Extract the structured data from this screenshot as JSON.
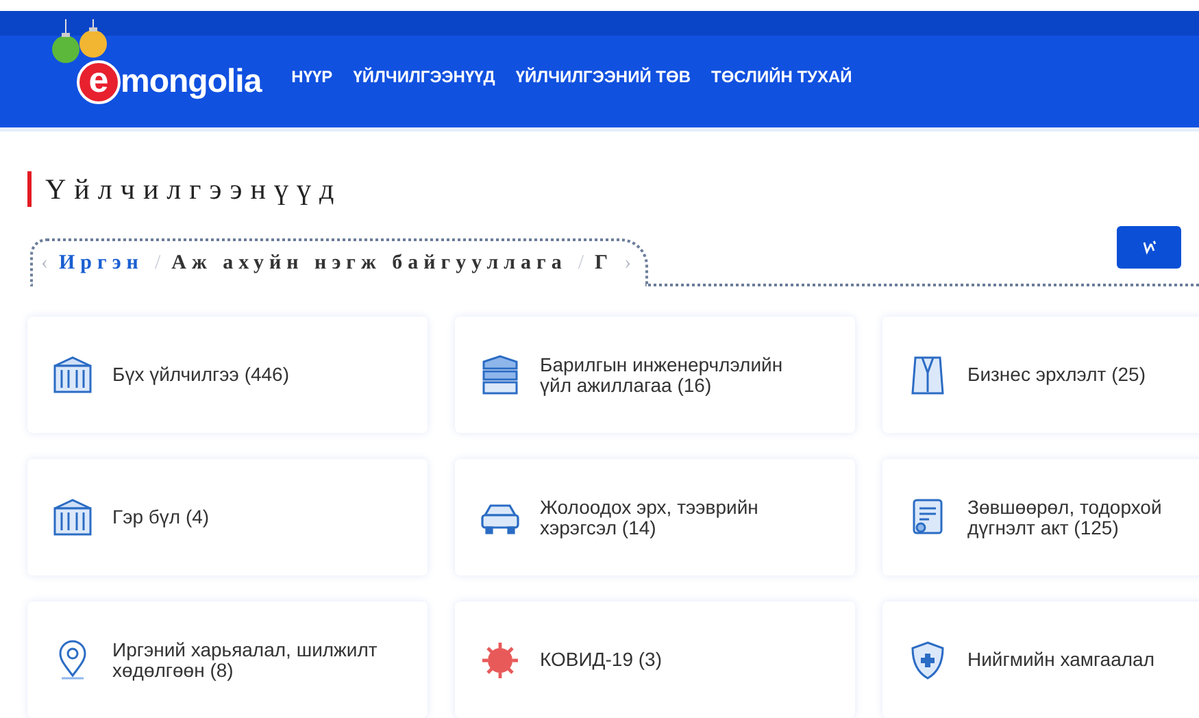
{
  "header": {
    "logo": {
      "letter": "e",
      "text": "mongolia"
    },
    "nav": [
      "НҮҮР",
      "ҮЙЛЧИЛГЭЭНҮҮД",
      "ҮЙЛЧИЛГЭЭНИЙ ТӨВ",
      "ТӨСЛИЙН ТУХАЙ"
    ]
  },
  "title": "Үйлчилгээнүүд",
  "breadcrumb": {
    "prev": "‹",
    "next": "›",
    "separator": "/",
    "items": [
      {
        "label": "Иргэн",
        "selected": true
      },
      {
        "label": "Аж ахуйн нэгж байгууллага",
        "selected": false
      },
      {
        "label": "Г",
        "selected": false
      }
    ]
  },
  "cards": [
    {
      "kind": "columns",
      "label": "Бүх үйлчилгээ (446)"
    },
    {
      "kind": "building",
      "label": "Барилгын инженерчлэлийн үйл ажиллагаа (16)"
    },
    {
      "kind": "suit",
      "label": "Бизнес эрхлэлт (25)"
    },
    {
      "kind": "columns",
      "label": "Гэр бүл (4)"
    },
    {
      "kind": "car",
      "label": "Жолоодох эрх, тээврийн хэрэгсэл (14)"
    },
    {
      "kind": "certificate",
      "label": "Зөвшөөрөл, тодорхой\nдүгнэлт акт (125)"
    },
    {
      "kind": "pin",
      "label": "Иргэний харьяалал, шилжилт хөдөлгөөн (8)"
    },
    {
      "kind": "virus",
      "label": "КОВИД-19 (3)"
    },
    {
      "kind": "shield",
      "label": "Нийгмийн хамгаалал"
    }
  ]
}
